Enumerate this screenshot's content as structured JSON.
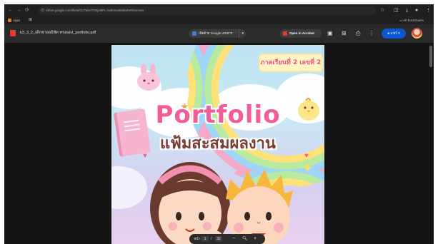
{
  "browser": {
    "address": "rdrive.google.com/file/d/1UTa5V7KBjz8fPL-lxdKSu5k8b6DvRbS/view",
    "bookmarks_apps": "Apps",
    "all_bookmarks": "All Bookmarks"
  },
  "pdf": {
    "file_name": "k3_3_2_เด็กชายอธิทัต ทรงแดง_portfolio.pdf",
    "open_with_label": "เปิดด้วย Google เอกสาร",
    "open_acrobat_label": "Open in Acrobat",
    "share_label": "แชร์"
  },
  "document": {
    "badge_text": "ภาคเรียนที่ 2 เลขที่ 2",
    "title_en": "Portfolio",
    "title_th": "แฟ้มสะสมผลงาน"
  },
  "page_controls": {
    "page_label": "หน้า",
    "current_page": "1",
    "separator": "/",
    "total_pages": "32"
  },
  "colors": {
    "accent_blue": "#0b57d0",
    "title_pink": "#f35c9a",
    "title_brown": "#7a3b33"
  }
}
